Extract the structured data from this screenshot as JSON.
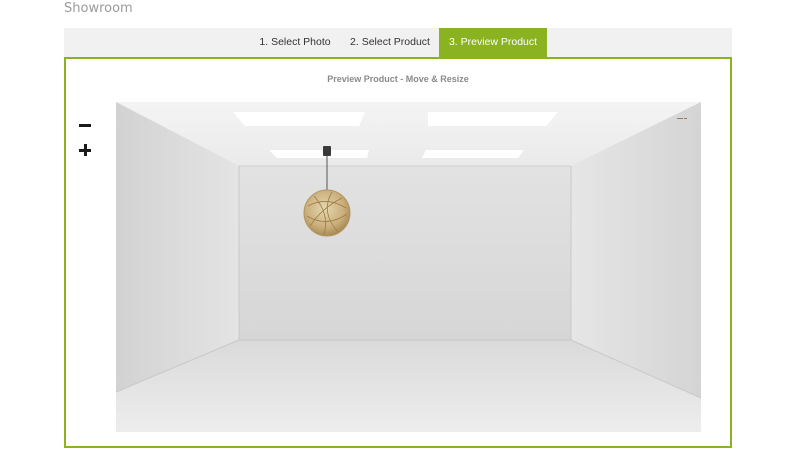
{
  "page": {
    "title": "Showroom"
  },
  "steps": [
    {
      "label": "1. Select Photo",
      "active": false
    },
    {
      "label": "2. Select Product",
      "active": false
    },
    {
      "label": "3. Preview Product",
      "active": true
    }
  ],
  "preview": {
    "heading": "Preview Product - Move & Resize",
    "zoom_out_icon": "minus-icon",
    "zoom_in_icon": "plus-icon",
    "product_icon": "pendant-lamp-icon"
  },
  "colors": {
    "accent": "#8bb321",
    "step_bar_bg": "#f1f1f1",
    "heading_text": "#8a8a8a"
  }
}
